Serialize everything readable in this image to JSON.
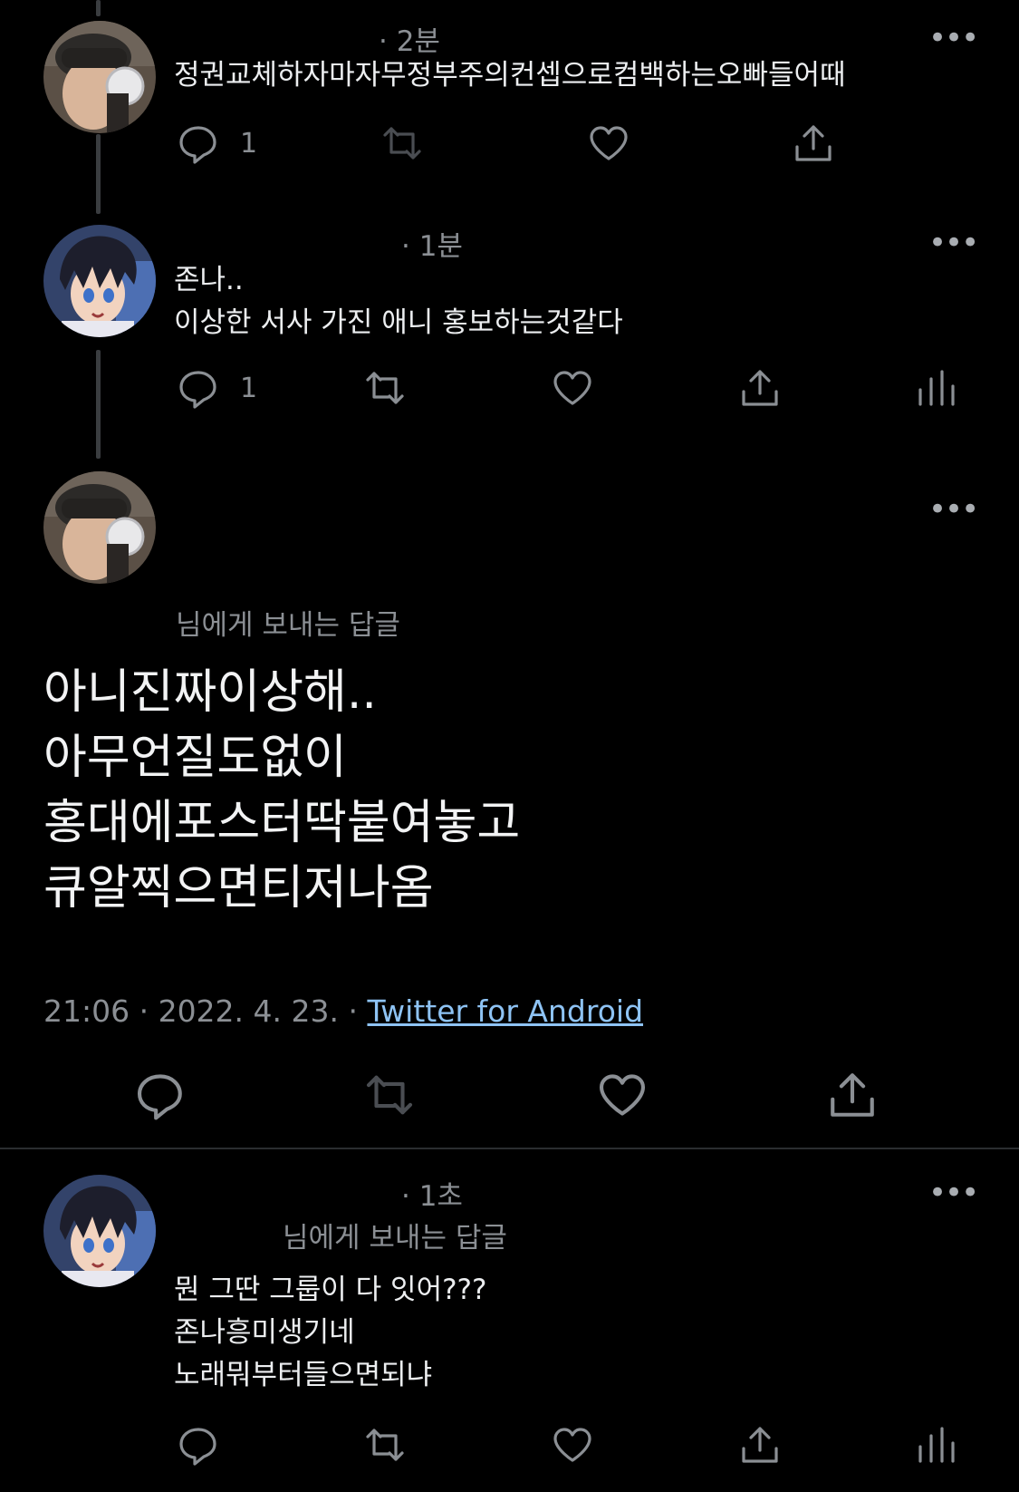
{
  "tweets": [
    {
      "time": "· 2분",
      "text": "정권교체하자마자무정부주의컨셉으로컴백하는오빠들어때",
      "reply_count": "1"
    },
    {
      "time": "· 1분",
      "text": "존나..\n이상한 서사 가진 애니 홍보하는것같다",
      "reply_count": "1"
    }
  ],
  "main_tweet": {
    "reply_to": "님에게 보내는 답글",
    "text": "아니진짜이상해..\n아무언질도없이\n홍대에포스터딱붙여놓고\n큐알찍으면티저나옴",
    "timestamp": "21:06 · 2022. 4. 23. · ",
    "source": "Twitter for Android"
  },
  "last_reply": {
    "time": "· 1초",
    "reply_to": "님에게 보내는 답글",
    "text": "뭔 그딴 그룹이 다 잇어???\n존나흥미생기네\n노래뭐부터들으면되냐"
  },
  "more_label": "•••",
  "icons": [
    "reply-icon",
    "retweet-icon",
    "like-icon",
    "share-icon",
    "analytics-icon",
    "more-icon"
  ],
  "colors": {
    "background": "#000000",
    "link": "#8ec3f4",
    "muted": "#8b8f94"
  }
}
